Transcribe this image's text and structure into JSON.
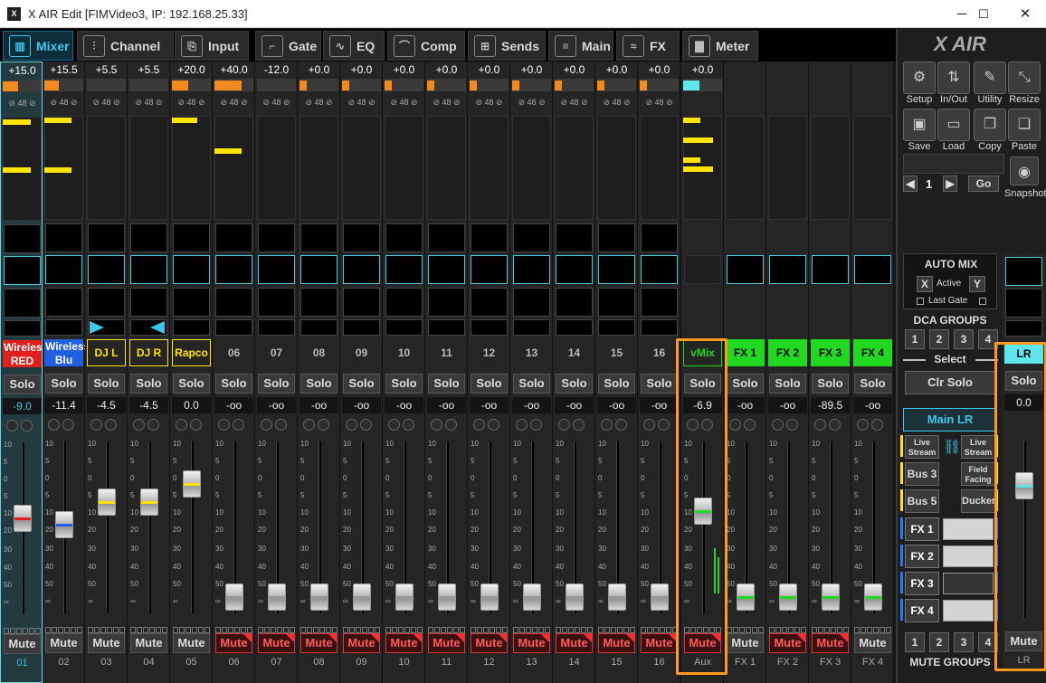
{
  "window": {
    "title": "X AIR Edit [FIMVideo3, IP: 192.168.25.33]",
    "app_icon": "X",
    "minimize": "─",
    "maximize": "☐",
    "close": "✕"
  },
  "tabs": [
    {
      "label": "Mixer",
      "icon": "▥"
    },
    {
      "label": "Channel",
      "icon": "⫶"
    },
    {
      "label": "Input",
      "icon": "⎘"
    },
    {
      "label": "Gate",
      "icon": "⌐"
    },
    {
      "label": "EQ",
      "icon": "∿"
    },
    {
      "label": "Comp",
      "icon": "⌒"
    },
    {
      "label": "Sends",
      "icon": "⊞"
    },
    {
      "label": "Main",
      "icon": "≡"
    },
    {
      "label": "FX",
      "icon": "≈"
    },
    {
      "label": "Meter",
      "icon": "▇"
    }
  ],
  "channels": [
    {
      "num": "01",
      "gain": "+15.0",
      "name": "Wireless RED",
      "level": "-9.0",
      "mute": "Mute",
      "solo": "Solo"
    },
    {
      "num": "02",
      "gain": "+15.5",
      "name": "Wireless Blu",
      "level": "-11.4",
      "mute": "Mute",
      "solo": "Solo"
    },
    {
      "num": "03",
      "gain": "+5.5",
      "name": "DJ L",
      "level": "-4.5",
      "mute": "Mute",
      "solo": "Solo"
    },
    {
      "num": "04",
      "gain": "+5.5",
      "name": "DJ R",
      "level": "-4.5",
      "mute": "Mute",
      "solo": "Solo"
    },
    {
      "num": "05",
      "gain": "+20.0",
      "name": "Rapco",
      "level": "0.0",
      "mute": "Mute",
      "solo": "Solo"
    },
    {
      "num": "06",
      "gain": "+40.0",
      "name": "06",
      "level": "-oo",
      "mute": "Mute",
      "solo": "Solo"
    },
    {
      "num": "07",
      "gain": "-12.0",
      "name": "07",
      "level": "-oo",
      "mute": "Mute",
      "solo": "Solo"
    },
    {
      "num": "08",
      "gain": "+0.0",
      "name": "08",
      "level": "-oo",
      "mute": "Mute",
      "solo": "Solo"
    },
    {
      "num": "09",
      "gain": "+0.0",
      "name": "09",
      "level": "-oo",
      "mute": "Mute",
      "solo": "Solo"
    },
    {
      "num": "10",
      "gain": "+0.0",
      "name": "10",
      "level": "-oo",
      "mute": "Mute",
      "solo": "Solo"
    },
    {
      "num": "11",
      "gain": "+0.0",
      "name": "11",
      "level": "-oo",
      "mute": "Mute",
      "solo": "Solo"
    },
    {
      "num": "12",
      "gain": "+0.0",
      "name": "12",
      "level": "-oo",
      "mute": "Mute",
      "solo": "Solo"
    },
    {
      "num": "13",
      "gain": "+0.0",
      "name": "13",
      "level": "-oo",
      "mute": "Mute",
      "solo": "Solo"
    },
    {
      "num": "14",
      "gain": "+0.0",
      "name": "14",
      "level": "-oo",
      "mute": "Mute",
      "solo": "Solo"
    },
    {
      "num": "15",
      "gain": "+0.0",
      "name": "15",
      "level": "-oo",
      "mute": "Mute",
      "solo": "Solo"
    },
    {
      "num": "16",
      "gain": "+0.0",
      "name": "16",
      "level": "-oo",
      "mute": "Mute",
      "solo": "Solo"
    },
    {
      "num": "Aux",
      "gain": "+0.0",
      "name": "vMix PC",
      "level": "-6.9",
      "mute": "Mute",
      "solo": "Solo"
    },
    {
      "num": "FX 1",
      "gain": "",
      "name": "FX 1",
      "level": "-oo",
      "mute": "Mute",
      "solo": "Solo"
    },
    {
      "num": "FX 2",
      "gain": "",
      "name": "FX 2",
      "level": "-oo",
      "mute": "Mute",
      "solo": "Solo"
    },
    {
      "num": "FX 3",
      "gain": "",
      "name": "FX 3",
      "level": "-89.5",
      "mute": "Mute",
      "solo": "Solo"
    },
    {
      "num": "FX 4",
      "gain": "",
      "name": "FX 4",
      "level": "-oo",
      "mute": "Mute",
      "solo": "Solo"
    }
  ],
  "fader_scale": [
    "10",
    "5",
    "0",
    "5",
    "10",
    "20",
    "30",
    "40",
    "50",
    "∞"
  ],
  "right": {
    "logo": "X AIR",
    "tools": [
      {
        "label": "Setup",
        "icon": "⚙"
      },
      {
        "label": "In/Out",
        "icon": "⇅"
      },
      {
        "label": "Utility",
        "icon": "✎"
      },
      {
        "label": "Resize",
        "icon": "⤡"
      },
      {
        "label": "Save",
        "icon": "▣"
      },
      {
        "label": "Load",
        "icon": "▭"
      },
      {
        "label": "Copy",
        "icon": "❐"
      },
      {
        "label": "Paste",
        "icon": "❏"
      }
    ],
    "snapshot_num": "1",
    "go": "Go",
    "snapshot": "Snapshot",
    "automix": {
      "title": "AUTO MIX",
      "x": "X",
      "active": "Active",
      "y": "Y",
      "last_gate": "Last Gate"
    },
    "dca_title": "DCA GROUPS",
    "dca": [
      "1",
      "2",
      "3",
      "4"
    ],
    "select": "Select",
    "clr_solo": "Clr Solo",
    "main_lr": "Main LR",
    "buses": [
      {
        "left": "Live Stream",
        "right": "Live Stream"
      },
      {
        "left": "Bus 3",
        "right": "Field Facing"
      },
      {
        "left": "Bus 5",
        "right": "Ducker"
      }
    ],
    "fx": [
      "FX 1",
      "FX 2",
      "FX 3",
      "FX 4"
    ],
    "mute_groups_title": "MUTE GROUPS",
    "mute_groups": [
      "1",
      "2",
      "3",
      "4"
    ],
    "lr": {
      "name": "LR",
      "solo": "Solo",
      "level": "0.0",
      "mute": "Mute",
      "label": "LR"
    }
  },
  "colors": {
    "accent": "#3cc8ee",
    "orange": "#ff9a1f",
    "mute_red": "#ff5b5b",
    "yellow": "#ffe500",
    "green": "#22d922"
  }
}
